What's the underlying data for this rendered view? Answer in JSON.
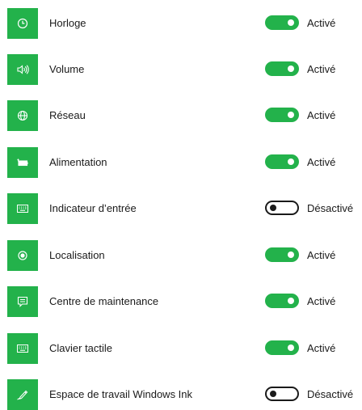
{
  "colors": {
    "accent": "#23b24b",
    "text": "#1a1a1a",
    "background": "#ffffff"
  },
  "items": [
    {
      "icon": "clock-icon",
      "label": "Horloge",
      "on": true,
      "state": "Activé"
    },
    {
      "icon": "volume-icon",
      "label": "Volume",
      "on": true,
      "state": "Activé"
    },
    {
      "icon": "globe-icon",
      "label": "Réseau",
      "on": true,
      "state": "Activé"
    },
    {
      "icon": "battery-icon",
      "label": "Alimentation",
      "on": true,
      "state": "Activé"
    },
    {
      "icon": "keyboard-icon",
      "label": "Indicateur d’entrée",
      "on": false,
      "state": "Désactivé"
    },
    {
      "icon": "location-icon",
      "label": "Localisation",
      "on": true,
      "state": "Activé"
    },
    {
      "icon": "action-center-icon",
      "label": "Centre de maintenance",
      "on": true,
      "state": "Activé"
    },
    {
      "icon": "keyboard-icon",
      "label": "Clavier tactile",
      "on": true,
      "state": "Activé"
    },
    {
      "icon": "pen-icon",
      "label": "Espace de travail Windows Ink",
      "on": false,
      "state": "Désactivé"
    }
  ]
}
